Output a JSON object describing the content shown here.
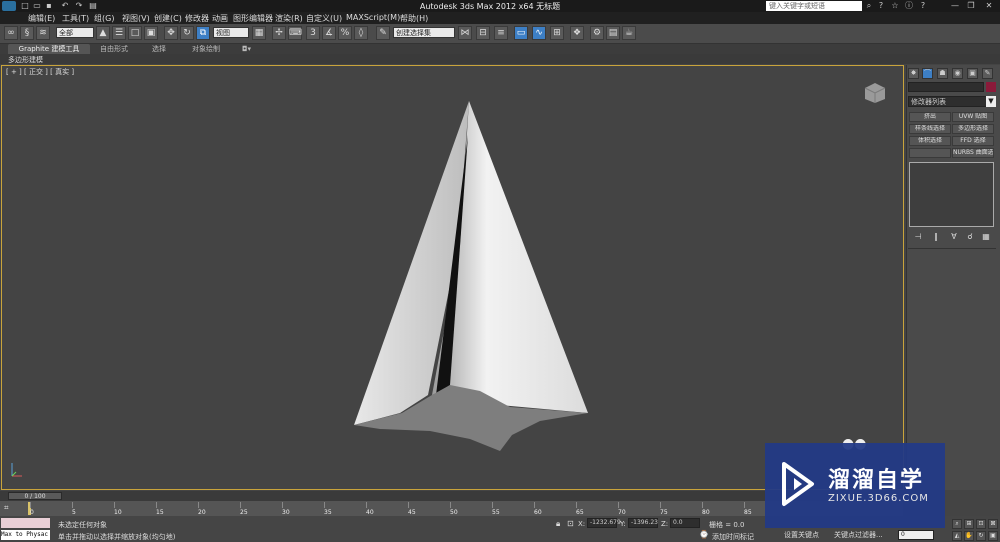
{
  "titlebar": {
    "title": "Autodesk 3ds Max  2012 x64      无标题",
    "search_placeholder": "键入关键字或短语"
  },
  "menu": [
    "编辑(E)",
    "工具(T)",
    "组(G)",
    "视图(V)",
    "创建(C)",
    "修改器",
    "动画",
    "图形编辑器",
    "渲染(R)",
    "自定义(U)",
    "MAXScript(M)",
    "帮助(H)"
  ],
  "toolbar": {
    "selection_filter": "全部",
    "reference_coord": "视图",
    "named_selection": "创建选择集"
  },
  "ribbon": {
    "tabs": [
      "Graphite 建模工具",
      "自由形式",
      "选择",
      "对象绘制"
    ],
    "sub_label": "多边形建模"
  },
  "viewport": {
    "label": "[ + ] [ 正交 ] [ 真实 ]"
  },
  "command_panel": {
    "modifier_list": "修改器列表",
    "buttons": [
      "挤出",
      "UVW 贴图",
      "样条线选择",
      "多边形选择",
      "体积选择",
      "FFD 选择",
      "",
      "NURBS 曲面选择"
    ]
  },
  "timeline": {
    "frame": "0 / 100",
    "ticks": [
      "0",
      "5",
      "10",
      "15",
      "20",
      "25",
      "30",
      "35",
      "40",
      "45",
      "50",
      "55",
      "60",
      "65",
      "70",
      "75",
      "80",
      "85"
    ]
  },
  "status": {
    "maxscript": "Max to Physac (",
    "line1": "未选定任何对象",
    "line2": "单击并拖动以选择并缩放对象(均匀地)",
    "x_label": "X:",
    "x_value": "-1232.679",
    "y_label": "Y:",
    "y_value": "-1396.23",
    "z_label": "Z:",
    "z_value": "0.0",
    "grid": "栅格 = 0.0",
    "add_tag": "添加时间标记",
    "set_key": "设置关键点",
    "key_filter": "关键点过滤器...",
    "frame_field": "0"
  },
  "watermark": {
    "title": "溜溜自学",
    "subtitle": "ZIXUE.3D66.COM"
  }
}
